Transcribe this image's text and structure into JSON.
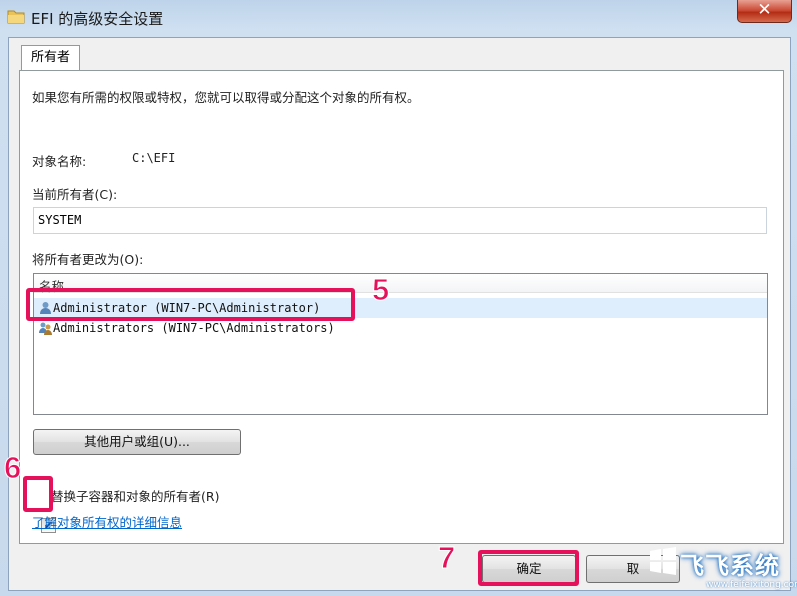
{
  "window": {
    "title": "EFI 的高级安全设置",
    "close_glyph": "✕"
  },
  "tabs": [
    {
      "label": "所有者",
      "selected": true
    }
  ],
  "owner_panel": {
    "intro": "如果您有所需的权限或特权，您就可以取得或分配这个对象的所有权。",
    "object_name_label": "对象名称:",
    "object_name_value": "C:\\EFI",
    "current_owner_label": "当前所有者(C):",
    "current_owner_value": "SYSTEM",
    "change_owner_label": "将所有者更改为(O):",
    "list": {
      "column_header": "名称",
      "rows": [
        {
          "text": "Administrator (WIN7-PC\\Administrator)",
          "icon": "user-icon",
          "selected": true
        },
        {
          "text": "Administrators (WIN7-PC\\Administrators)",
          "icon": "group-icon",
          "selected": false
        }
      ]
    },
    "other_users_button": "其他用户或组(U)...",
    "replace_checkbox_label": "替换子容器和对象的所有者(R)",
    "replace_checked": true,
    "learn_more_link": "了解对象所有权的详细信息"
  },
  "buttons": {
    "ok": "确定",
    "cancel": "取"
  },
  "annotations": {
    "step5": "5",
    "step6": "6",
    "step7": "7",
    "highlight_color": "#e6115b"
  },
  "watermark": {
    "title": "飞飞系统",
    "url": "www.feifeixitong.com"
  }
}
